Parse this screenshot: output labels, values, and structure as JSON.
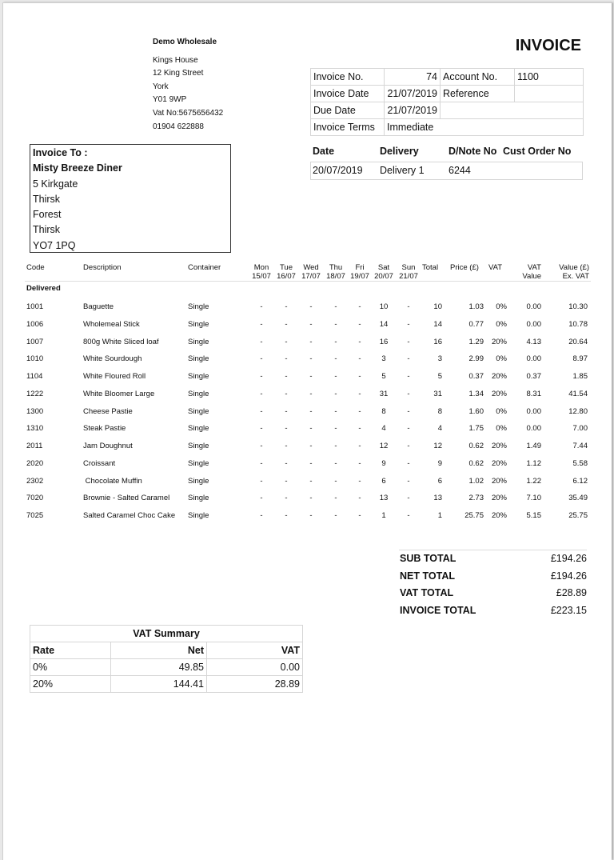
{
  "document": {
    "title": "INVOICE"
  },
  "company": {
    "name": "Demo Wholesale",
    "address": [
      "Kings House",
      "12 King Street",
      "York",
      "Y01 9WP",
      "Vat No:5675656432",
      "01904 622888"
    ]
  },
  "invoice_meta": {
    "invoice_no_label": "Invoice No.",
    "invoice_no": "74",
    "account_no_label": "Account No.",
    "account_no": "1100",
    "invoice_date_label": "Invoice Date",
    "invoice_date": "21/07/2019",
    "reference_label": "Reference",
    "reference": "",
    "due_date_label": "Due Date",
    "due_date": "21/07/2019",
    "terms_label": "Invoice Terms",
    "terms": "Immediate"
  },
  "delivery": {
    "headers": {
      "date": "Date",
      "delivery": "Delivery",
      "dnote": "D/Note No",
      "cust_order": "Cust Order No"
    },
    "date": "20/07/2019",
    "delivery": "Delivery 1",
    "dnote": "6244",
    "cust_order": ""
  },
  "invoice_to": {
    "label": "Invoice To :",
    "name": "Misty Breeze Diner",
    "address": [
      "5 Kirkgate",
      "Thirsk",
      "Forest",
      "Thirsk",
      "YO7 1PQ"
    ]
  },
  "items_table": {
    "headers": {
      "code": "Code",
      "description": "Description",
      "container": "Container",
      "days": [
        {
          "day": "Mon",
          "date": "15/07"
        },
        {
          "day": "Tue",
          "date": "16/07"
        },
        {
          "day": "Wed",
          "date": "17/07"
        },
        {
          "day": "Thu",
          "date": "18/07"
        },
        {
          "day": "Fri",
          "date": "19/07"
        },
        {
          "day": "Sat",
          "date": "20/07"
        },
        {
          "day": "Sun",
          "date": "21/07"
        }
      ],
      "total": "Total",
      "price": "Price (£)",
      "vat": "VAT",
      "vat_value_1": "VAT",
      "vat_value_2": "Value",
      "value_1": "Value (£)",
      "value_2": "Ex. VAT"
    },
    "section_label": "Delivered",
    "rows": [
      {
        "code": "1001",
        "description": "Baguette",
        "container": "Single",
        "days": [
          "-",
          "-",
          "-",
          "-",
          "-",
          "10",
          "-"
        ],
        "total": "10",
        "price": "1.03",
        "vat": "0%",
        "vat_value": "0.00",
        "value": "10.30"
      },
      {
        "code": "1006",
        "description": "Wholemeal Stick",
        "container": "Single",
        "days": [
          "-",
          "-",
          "-",
          "-",
          "-",
          "14",
          "-"
        ],
        "total": "14",
        "price": "0.77",
        "vat": "0%",
        "vat_value": "0.00",
        "value": "10.78"
      },
      {
        "code": "1007",
        "description": "800g White Sliced loaf",
        "container": "Single",
        "days": [
          "-",
          "-",
          "-",
          "-",
          "-",
          "16",
          "-"
        ],
        "total": "16",
        "price": "1.29",
        "vat": "20%",
        "vat_value": "4.13",
        "value": "20.64"
      },
      {
        "code": "1010",
        "description": "White Sourdough",
        "container": "Single",
        "days": [
          "-",
          "-",
          "-",
          "-",
          "-",
          "3",
          "-"
        ],
        "total": "3",
        "price": "2.99",
        "vat": "0%",
        "vat_value": "0.00",
        "value": "8.97"
      },
      {
        "code": "1104",
        "description": "White Floured Roll",
        "container": "Single",
        "days": [
          "-",
          "-",
          "-",
          "-",
          "-",
          "5",
          "-"
        ],
        "total": "5",
        "price": "0.37",
        "vat": "20%",
        "vat_value": "0.37",
        "value": "1.85"
      },
      {
        "code": "1222",
        "description": "White Bloomer Large",
        "container": "Single",
        "days": [
          "-",
          "-",
          "-",
          "-",
          "-",
          "31",
          "-"
        ],
        "total": "31",
        "price": "1.34",
        "vat": "20%",
        "vat_value": "8.31",
        "value": "41.54"
      },
      {
        "code": "1300",
        "description": "Cheese Pastie",
        "container": "Single",
        "days": [
          "-",
          "-",
          "-",
          "-",
          "-",
          "8",
          "-"
        ],
        "total": "8",
        "price": "1.60",
        "vat": "0%",
        "vat_value": "0.00",
        "value": "12.80"
      },
      {
        "code": "1310",
        "description": "Steak Pastie",
        "container": "Single",
        "days": [
          "-",
          "-",
          "-",
          "-",
          "-",
          "4",
          "-"
        ],
        "total": "4",
        "price": "1.75",
        "vat": "0%",
        "vat_value": "0.00",
        "value": "7.00"
      },
      {
        "code": "2011",
        "description": "Jam Doughnut",
        "container": "Single",
        "days": [
          "-",
          "-",
          "-",
          "-",
          "-",
          "12",
          "-"
        ],
        "total": "12",
        "price": "0.62",
        "vat": "20%",
        "vat_value": "1.49",
        "value": "7.44"
      },
      {
        "code": "2020",
        "description": "Croissant",
        "container": "Single",
        "days": [
          "-",
          "-",
          "-",
          "-",
          "-",
          "9",
          "-"
        ],
        "total": "9",
        "price": "0.62",
        "vat": "20%",
        "vat_value": "1.12",
        "value": "5.58"
      },
      {
        "code": "2302",
        "description": " Chocolate Muffin",
        "container": "Single",
        "days": [
          "-",
          "-",
          "-",
          "-",
          "-",
          "6",
          "-"
        ],
        "total": "6",
        "price": "1.02",
        "vat": "20%",
        "vat_value": "1.22",
        "value": "6.12"
      },
      {
        "code": "7020",
        "description": "Brownie - Salted Caramel",
        "container": "Single",
        "days": [
          "-",
          "-",
          "-",
          "-",
          "-",
          "13",
          "-"
        ],
        "total": "13",
        "price": "2.73",
        "vat": "20%",
        "vat_value": "7.10",
        "value": "35.49"
      },
      {
        "code": "7025",
        "description": "Salted Caramel Choc Cake",
        "container": "Single",
        "days": [
          "-",
          "-",
          "-",
          "-",
          "-",
          "1",
          "-"
        ],
        "total": "1",
        "price": "25.75",
        "vat": "20%",
        "vat_value": "5.15",
        "value": "25.75"
      }
    ]
  },
  "totals": [
    {
      "label": "SUB TOTAL",
      "value": "£194.26"
    },
    {
      "label": "NET TOTAL",
      "value": "£194.26"
    },
    {
      "label": "VAT TOTAL",
      "value": "£28.89"
    },
    {
      "label": "INVOICE TOTAL",
      "value": "£223.15"
    }
  ],
  "vat_summary": {
    "title": "VAT Summary",
    "headers": {
      "rate": "Rate",
      "net": "Net",
      "vat": "VAT"
    },
    "rows": [
      {
        "rate": "0%",
        "net": "49.85",
        "vat": "0.00"
      },
      {
        "rate": "20%",
        "net": "144.41",
        "vat": "28.89"
      }
    ]
  }
}
